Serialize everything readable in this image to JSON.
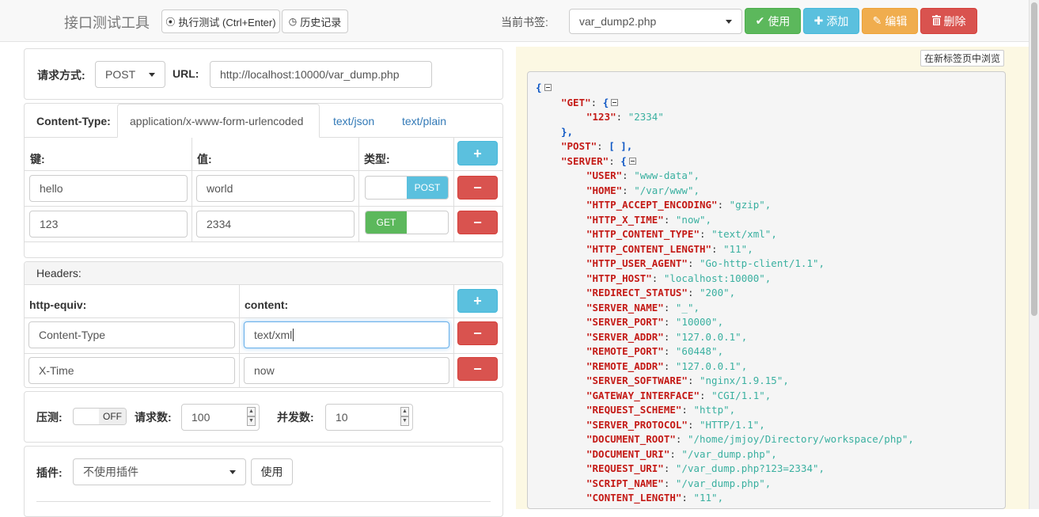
{
  "header": {
    "app_title": "接口测试工具",
    "run_button": "执行测试 (Ctrl+Enter)",
    "history_button": "历史记录",
    "bookmark_label": "当前书签:",
    "bookmark_value": "var_dump2.php",
    "use_button": "使用",
    "add_button": "添加",
    "edit_button": "编辑",
    "delete_button": "删除",
    "colors": {
      "use": "#5cb85c",
      "add": "#5bc0de",
      "edit": "#f0ad4e",
      "delete": "#d9534f"
    }
  },
  "request": {
    "method_label": "请求方式:",
    "method_value": "POST",
    "url_label": "URL:",
    "url_value": "http://localhost:10000/var_dump.php"
  },
  "content_type": {
    "label": "Content-Type:",
    "tabs": [
      "application/x-www-form-urlencoded",
      "text/json",
      "text/plain"
    ],
    "active_tab": "application/x-www-form-urlencoded",
    "columns": {
      "key": "键:",
      "value": "值:",
      "type": "类型:"
    },
    "add_icon": "plus-icon",
    "remove_icon": "minus-icon",
    "rows": [
      {
        "key": "hello",
        "value": "world",
        "type": "POST"
      },
      {
        "key": "123",
        "value": "2334",
        "type": "GET"
      }
    ],
    "type_colors": {
      "POST": "#5bc0de",
      "GET": "#5cb85c"
    }
  },
  "headers": {
    "title": "Headers:",
    "columns": {
      "name": "http-equiv:",
      "content": "content:"
    },
    "rows": [
      {
        "name": "Content-Type",
        "content": "text/xml"
      },
      {
        "name": "X-Time",
        "content": "now"
      }
    ]
  },
  "stress": {
    "label": "压测:",
    "toggle": "OFF",
    "requests_label": "请求数:",
    "requests_value": "100",
    "concurrency_label": "并发数:",
    "concurrency_value": "10"
  },
  "plugin": {
    "label": "插件:",
    "value": "不使用插件",
    "use_button": "使用"
  },
  "result": {
    "new_tab_button": "在新标签页中浏览",
    "lines": [
      {
        "indent": 0,
        "open": "{",
        "collapse": true
      },
      {
        "indent": 1,
        "key": "\"GET\"",
        "open": "{",
        "collapse": true
      },
      {
        "indent": 2,
        "key": "\"123\"",
        "value": "\"2334\""
      },
      {
        "indent": 1,
        "close": "},"
      },
      {
        "indent": 1,
        "key": "\"POST\"",
        "bracket": "[ ],"
      },
      {
        "indent": 1,
        "key": "\"SERVER\"",
        "open": "{",
        "collapse": true
      },
      {
        "indent": 2,
        "key": "\"USER\"",
        "value": "\"www-data\","
      },
      {
        "indent": 2,
        "key": "\"HOME\"",
        "value": "\"/var/www\","
      },
      {
        "indent": 2,
        "key": "\"HTTP_ACCEPT_ENCODING\"",
        "value": "\"gzip\","
      },
      {
        "indent": 2,
        "key": "\"HTTP_X_TIME\"",
        "value": "\"now\","
      },
      {
        "indent": 2,
        "key": "\"HTTP_CONTENT_TYPE\"",
        "value": "\"text/xml\","
      },
      {
        "indent": 2,
        "key": "\"HTTP_CONTENT_LENGTH\"",
        "value": "\"11\","
      },
      {
        "indent": 2,
        "key": "\"HTTP_USER_AGENT\"",
        "value": "\"Go-http-client/1.1\","
      },
      {
        "indent": 2,
        "key": "\"HTTP_HOST\"",
        "value": "\"localhost:10000\","
      },
      {
        "indent": 2,
        "key": "\"REDIRECT_STATUS\"",
        "value": "\"200\","
      },
      {
        "indent": 2,
        "key": "\"SERVER_NAME\"",
        "value": "\"_\","
      },
      {
        "indent": 2,
        "key": "\"SERVER_PORT\"",
        "value": "\"10000\","
      },
      {
        "indent": 2,
        "key": "\"SERVER_ADDR\"",
        "value": "\"127.0.0.1\","
      },
      {
        "indent": 2,
        "key": "\"REMOTE_PORT\"",
        "value": "\"60448\","
      },
      {
        "indent": 2,
        "key": "\"REMOTE_ADDR\"",
        "value": "\"127.0.0.1\","
      },
      {
        "indent": 2,
        "key": "\"SERVER_SOFTWARE\"",
        "value": "\"nginx/1.9.15\","
      },
      {
        "indent": 2,
        "key": "\"GATEWAY_INTERFACE\"",
        "value": "\"CGI/1.1\","
      },
      {
        "indent": 2,
        "key": "\"REQUEST_SCHEME\"",
        "value": "\"http\","
      },
      {
        "indent": 2,
        "key": "\"SERVER_PROTOCOL\"",
        "value": "\"HTTP/1.1\","
      },
      {
        "indent": 2,
        "key": "\"DOCUMENT_ROOT\"",
        "value": "\"/home/jmjoy/Directory/workspace/php\","
      },
      {
        "indent": 2,
        "key": "\"DOCUMENT_URI\"",
        "value": "\"/var_dump.php\","
      },
      {
        "indent": 2,
        "key": "\"REQUEST_URI\"",
        "value": "\"/var_dump.php?123=2334\","
      },
      {
        "indent": 2,
        "key": "\"SCRIPT_NAME\"",
        "value": "\"/var_dump.php\","
      },
      {
        "indent": 2,
        "key": "\"CONTENT_LENGTH\"",
        "value": "\"11\","
      }
    ]
  }
}
